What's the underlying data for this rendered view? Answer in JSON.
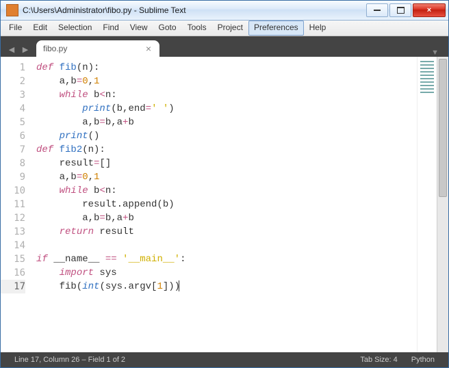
{
  "window": {
    "title": "C:\\Users\\Administrator\\fibo.py - Sublime Text"
  },
  "menu": {
    "items": [
      "File",
      "Edit",
      "Selection",
      "Find",
      "View",
      "Goto",
      "Tools",
      "Project",
      "Preferences",
      "Help"
    ],
    "hover_index": 8
  },
  "tabs": {
    "items": [
      {
        "label": "fibo.py"
      }
    ]
  },
  "code": {
    "lines": [
      [
        {
          "t": "def ",
          "c": "kw"
        },
        {
          "t": "fib",
          "c": "fn"
        },
        {
          "t": "(n):",
          "c": "id"
        }
      ],
      [
        {
          "t": "    a,b",
          "c": "id"
        },
        {
          "t": "=",
          "c": "op"
        },
        {
          "t": "0",
          "c": "num"
        },
        {
          "t": ",",
          "c": "id"
        },
        {
          "t": "1",
          "c": "num"
        }
      ],
      [
        {
          "t": "    ",
          "c": ""
        },
        {
          "t": "while",
          "c": "kw"
        },
        {
          "t": " b",
          "c": "id"
        },
        {
          "t": "<",
          "c": "op"
        },
        {
          "t": "n:",
          "c": "id"
        }
      ],
      [
        {
          "t": "        ",
          "c": ""
        },
        {
          "t": "print",
          "c": "bi"
        },
        {
          "t": "(b,end",
          "c": "id"
        },
        {
          "t": "=",
          "c": "op"
        },
        {
          "t": "' '",
          "c": "str"
        },
        {
          "t": ")",
          "c": "id"
        }
      ],
      [
        {
          "t": "        a,b",
          "c": "id"
        },
        {
          "t": "=",
          "c": "op"
        },
        {
          "t": "b,a",
          "c": "id"
        },
        {
          "t": "+",
          "c": "op"
        },
        {
          "t": "b",
          "c": "id"
        }
      ],
      [
        {
          "t": "    ",
          "c": ""
        },
        {
          "t": "print",
          "c": "bi"
        },
        {
          "t": "()",
          "c": "id"
        }
      ],
      [
        {
          "t": "def ",
          "c": "kw"
        },
        {
          "t": "fib2",
          "c": "fn"
        },
        {
          "t": "(n):",
          "c": "id"
        }
      ],
      [
        {
          "t": "    result",
          "c": "id"
        },
        {
          "t": "=",
          "c": "op"
        },
        {
          "t": "[]",
          "c": "id"
        }
      ],
      [
        {
          "t": "    a,b",
          "c": "id"
        },
        {
          "t": "=",
          "c": "op"
        },
        {
          "t": "0",
          "c": "num"
        },
        {
          "t": ",",
          "c": "id"
        },
        {
          "t": "1",
          "c": "num"
        }
      ],
      [
        {
          "t": "    ",
          "c": ""
        },
        {
          "t": "while",
          "c": "kw"
        },
        {
          "t": " b",
          "c": "id"
        },
        {
          "t": "<",
          "c": "op"
        },
        {
          "t": "n:",
          "c": "id"
        }
      ],
      [
        {
          "t": "        result.append(b)",
          "c": "id"
        }
      ],
      [
        {
          "t": "        a,b",
          "c": "id"
        },
        {
          "t": "=",
          "c": "op"
        },
        {
          "t": "b,a",
          "c": "id"
        },
        {
          "t": "+",
          "c": "op"
        },
        {
          "t": "b",
          "c": "id"
        }
      ],
      [
        {
          "t": "    ",
          "c": ""
        },
        {
          "t": "return",
          "c": "kw"
        },
        {
          "t": " result",
          "c": "id"
        }
      ],
      [],
      [
        {
          "t": "if",
          "c": "kw"
        },
        {
          "t": " __name__ ",
          "c": "id"
        },
        {
          "t": "==",
          "c": "op"
        },
        {
          "t": " ",
          "c": ""
        },
        {
          "t": "'__main__'",
          "c": "str"
        },
        {
          "t": ":",
          "c": "id"
        }
      ],
      [
        {
          "t": "    ",
          "c": ""
        },
        {
          "t": "import",
          "c": "kw"
        },
        {
          "t": " sys",
          "c": "id"
        }
      ],
      [
        {
          "t": "    fib(",
          "c": "id"
        },
        {
          "t": "int",
          "c": "bi"
        },
        {
          "t": "(sys.argv[",
          "c": "id"
        },
        {
          "t": "1",
          "c": "num"
        },
        {
          "t": "]))",
          "c": "id"
        }
      ]
    ],
    "current_line": 17
  },
  "status": {
    "left": "Line 17, Column 26 – Field 1 of 2",
    "tabsize": "Tab Size: 4",
    "lang": "Python"
  }
}
